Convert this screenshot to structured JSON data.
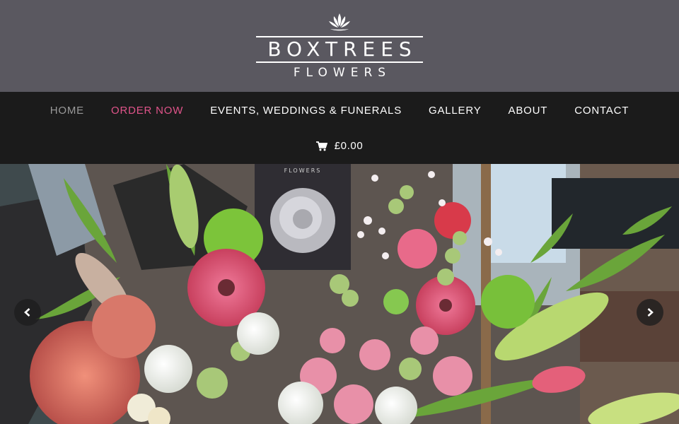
{
  "brand": {
    "main": "BOXTREES",
    "sub": "FLOWERS",
    "logo_icon": "lotus-flower-icon"
  },
  "nav": {
    "items": [
      {
        "label": "HOME",
        "state": "current"
      },
      {
        "label": "ORDER NOW",
        "state": "highlight"
      },
      {
        "label": "EVENTS, WEDDINGS & FUNERALS",
        "state": "normal"
      },
      {
        "label": "GALLERY",
        "state": "normal"
      },
      {
        "label": "ABOUT",
        "state": "normal"
      },
      {
        "label": "CONTACT",
        "state": "normal"
      }
    ],
    "cart_total": "£0.00",
    "cart_icon": "shopping-cart-icon"
  },
  "hero": {
    "image": "bouquet-photo",
    "card_text": "FLOWERS",
    "prev_icon": "chevron-left-icon",
    "next_icon": "chevron-right-icon"
  },
  "colors": {
    "header_bg": "#5a5860",
    "nav_bg": "#1b1b1b",
    "accent": "#e0548a",
    "current": "#9a9a9a"
  }
}
